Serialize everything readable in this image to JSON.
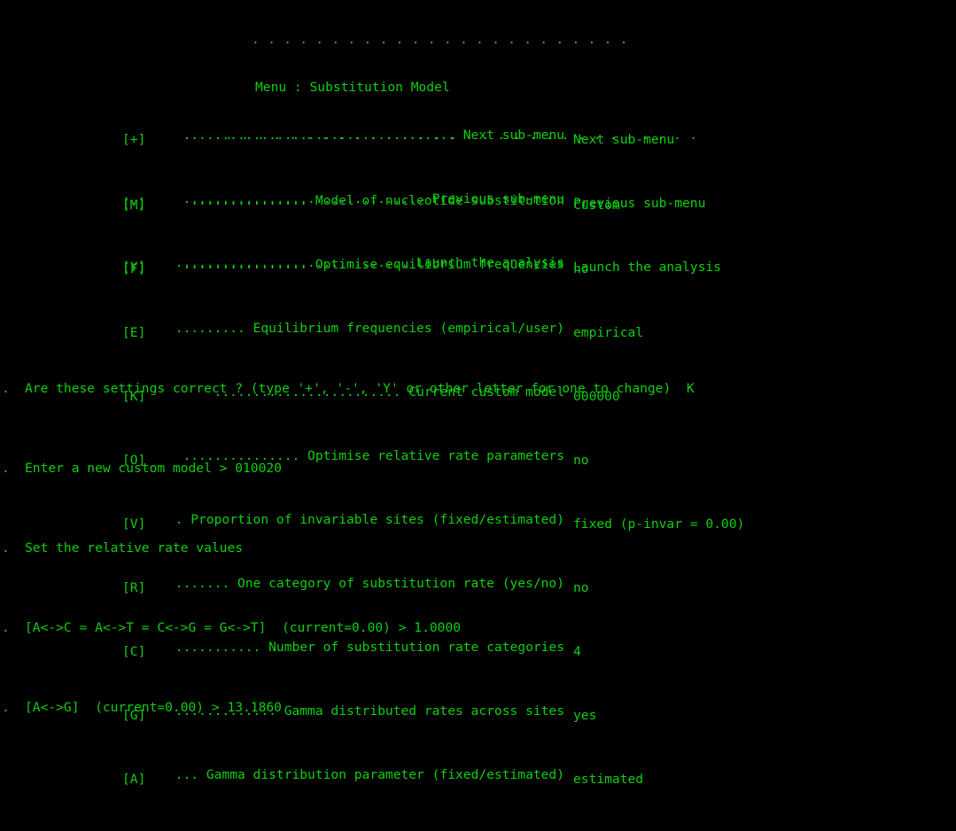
{
  "header": {
    "rule_top": ". . . . . . . . . . . . . . . . . . . . . . . .",
    "title": "Menu : Substitution Model",
    "rule_bottom": ". . . . . . . . . . . . . . . . . . . . . . . . . . . . . ."
  },
  "nav_items": [
    {
      "key": "[+]",
      "leader": "...................................",
      "label": "Next sub-menu"
    },
    {
      "key": "[-]",
      "leader": "...............................",
      "label": "Previous sub-menu"
    },
    {
      "key": "[Y]",
      "leader": "..............................",
      "label": "Launch the analysis"
    }
  ],
  "options": [
    {
      "key": "[M]",
      "leader": "...............",
      "label": "Model of nucleotide substitution",
      "value": "Custom"
    },
    {
      "key": "[F]",
      "leader": "................",
      "label": "Optimise equilibrium frequencies",
      "value": "no"
    },
    {
      "key": "[E]",
      "leader": ".........",
      "label": "Equilibrium frequencies (empirical/user)",
      "value": "empirical"
    },
    {
      "key": "[K]",
      "leader": "........................",
      "label": "Current custom model",
      "value": "000000"
    },
    {
      "key": "[O]",
      "leader": "...............",
      "label": "Optimise relative rate parameters",
      "value": "no"
    },
    {
      "key": "[V]",
      "leader": ".",
      "label": "Proportion of invariable sites (fixed/estimated)",
      "value": "fixed (p-invar = 0.00)"
    },
    {
      "key": "[R]",
      "leader": ".......",
      "label": "One category of substitution rate (yes/no)",
      "value": "no"
    },
    {
      "key": "[C]",
      "leader": "...........",
      "label": "Number of substitution rate categories",
      "value": "4"
    },
    {
      "key": "[G]",
      "leader": ".............",
      "label": "Gamma distributed rates across sites",
      "value": "yes"
    },
    {
      "key": "[A]",
      "leader": "...",
      "label": "Gamma distribution parameter (fixed/estimated)",
      "value": "estimated"
    }
  ],
  "prompts": [
    {
      "marker": ".",
      "text": "Are these settings correct ? (type '+', '-', 'Y' or other letter for one to change)  K"
    },
    {
      "marker": ".",
      "text": "Enter a new custom model > 010020"
    },
    {
      "marker": ".",
      "text": "Set the relative rate values"
    },
    {
      "marker": ".",
      "text": "[A<->C = A<->T = C<->G = G<->T]  (current=0.00) > 1.0000"
    },
    {
      "marker": ".",
      "text": "[A<->G]  (current=0.00) > 13.1860"
    }
  ],
  "colors": {
    "background": "#000000",
    "foreground": "#10cf10"
  }
}
